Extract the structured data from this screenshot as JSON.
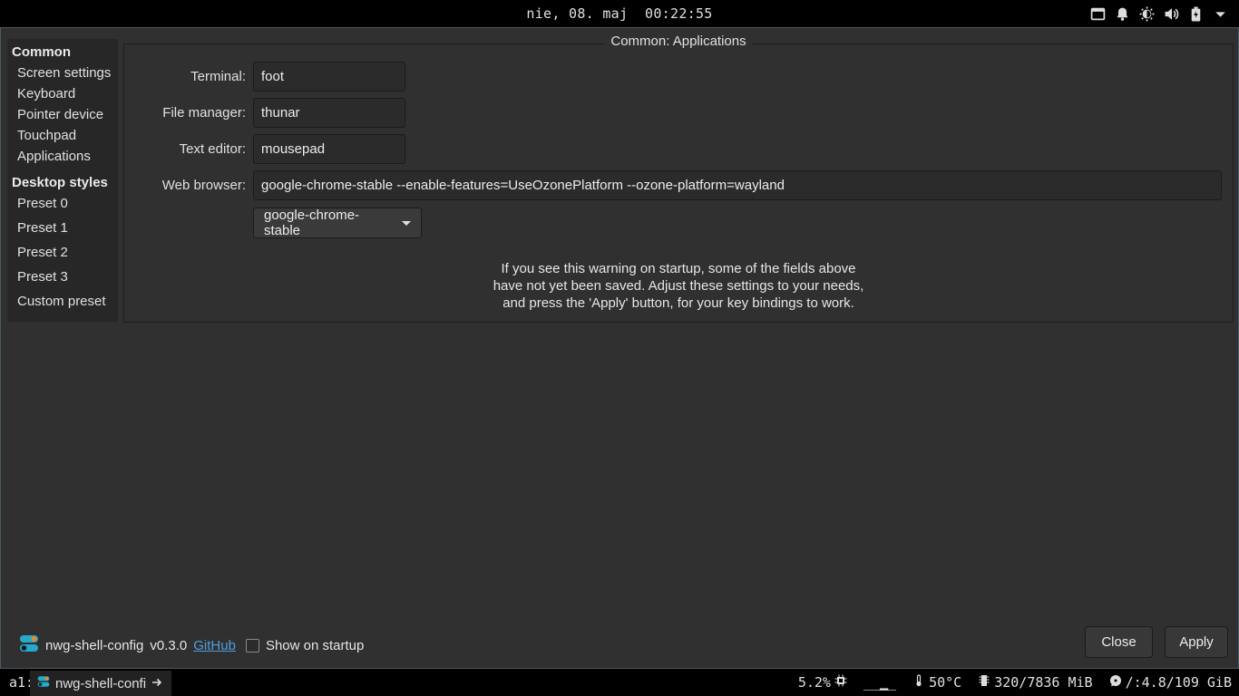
{
  "topbar": {
    "clock": "nie, 08. maj  00:22:55",
    "tray_icons": [
      "window-icon",
      "bell-icon",
      "brightness-icon",
      "volume-icon",
      "battery-icon",
      "chevron-down-icon"
    ]
  },
  "window": {
    "sidebar": {
      "common_heading": "Common",
      "common_items": [
        "Screen settings",
        "Keyboard",
        "Pointer device",
        "Touchpad",
        "Applications"
      ],
      "styles_heading": "Desktop styles",
      "styles_items": [
        "Preset 0",
        "Preset 1",
        "Preset 2",
        "Preset 3",
        "Custom preset"
      ]
    },
    "frame_title": "Common: Applications",
    "fields": {
      "terminal_label": "Terminal:",
      "terminal_value": "foot",
      "file_manager_label": "File manager:",
      "file_manager_value": "thunar",
      "text_editor_label": "Text editor:",
      "text_editor_value": "mousepad",
      "web_browser_label": "Web browser:",
      "web_browser_value": "google-chrome-stable --enable-features=UseOzonePlatform --ozone-platform=wayland"
    },
    "browser_combo": "google-chrome-stable",
    "warning_lines": [
      "If you see this warning on startup, some of the fields above",
      "have not yet been saved. Adjust these settings to your needs,",
      "and press the 'Apply' button, for your key bindings to work."
    ],
    "footer": {
      "app_name": "nwg-shell-config",
      "version": "v0.3.0",
      "github_link": "GitHub",
      "show_on_startup": "Show on startup",
      "show_on_startup_checked": false
    },
    "buttons": {
      "close": "Close",
      "apply": "Apply"
    }
  },
  "taskbar": {
    "workspace": "a1:",
    "task_label": "nwg-shell-confi",
    "cpu": "5.2%",
    "load_graph": "__▁_",
    "temperature": "50°C",
    "memory": "320/7836 MiB",
    "disk": "/:4.8/109 GiB"
  }
}
